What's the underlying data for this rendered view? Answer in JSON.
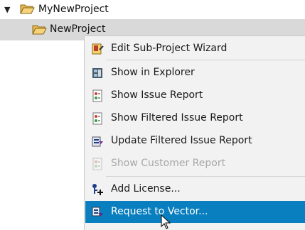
{
  "tree": {
    "root": {
      "label": "MyNewProject",
      "expander": "▼"
    },
    "child": {
      "label": "NewProject"
    }
  },
  "context_menu": {
    "items": [
      {
        "label": "Edit Sub-Project Wizard",
        "icon": "wizard-icon",
        "enabled": true
      },
      {
        "label": "Show in Explorer",
        "icon": "explorer-icon",
        "enabled": true
      },
      {
        "label": "Show Issue Report",
        "icon": "issue-report-icon",
        "enabled": true
      },
      {
        "label": "Show Filtered Issue Report",
        "icon": "filtered-issue-report-icon",
        "enabled": true
      },
      {
        "label": "Update Filtered Issue Report",
        "icon": "update-report-icon",
        "enabled": true
      },
      {
        "label": "Show Customer Report",
        "icon": "customer-report-icon",
        "enabled": false
      },
      {
        "label": "Add License...",
        "icon": "add-license-icon",
        "enabled": true
      },
      {
        "label": "Request to Vector...",
        "icon": "request-icon",
        "enabled": true,
        "highlighted": true
      }
    ]
  },
  "colors": {
    "highlight": "#0a7fbf",
    "selected_row": "#d9d9d9",
    "menu_bg": "#f2f2f2",
    "folder": "#f2c55c"
  }
}
